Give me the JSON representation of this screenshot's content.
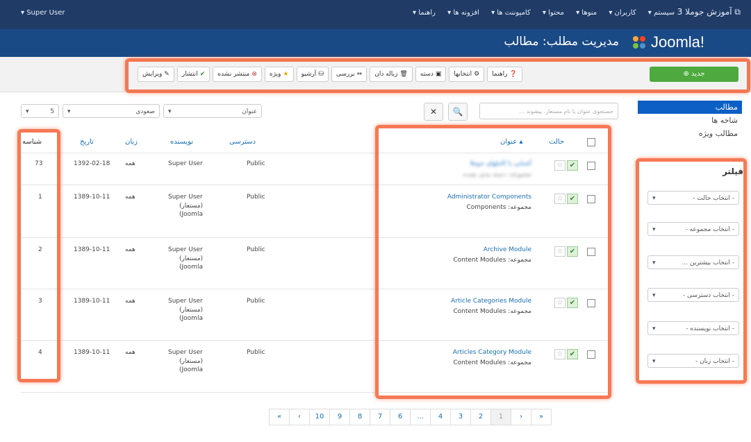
{
  "topbar": {
    "user_menu": "▾ Super User",
    "site_name": "آموزش جوملا 3 ⧉",
    "menu": [
      "سیستم ▾",
      "کاربران ▾",
      "منوها ▾",
      "محتوا ▾",
      "کامپوننت ها ▾",
      "افزونه ها ▾",
      "راهنما ▾"
    ]
  },
  "header": {
    "title": "مدیریت مطلب: مطالب",
    "logo_text": "Joomla!"
  },
  "toolbar": {
    "new_label": "⊕ جدید",
    "buttons": [
      {
        "icon": "✎",
        "label": "ویرایش"
      },
      {
        "icon": "✔",
        "label": "انتشار"
      },
      {
        "icon": "⊗",
        "label": "منتشر نشده"
      },
      {
        "icon": "★",
        "label": "ویژه"
      },
      {
        "icon": "⛁",
        "label": "آرشیو"
      },
      {
        "icon": "⇔",
        "label": "بررسی"
      },
      {
        "icon": "🗑",
        "label": "زباله دان"
      },
      {
        "icon": "▣",
        "label": "دسته"
      },
      {
        "icon": "⚙",
        "label": "انتخابها"
      },
      {
        "icon": "❓",
        "label": "راهنما"
      }
    ]
  },
  "sidebar": {
    "items": [
      "مطالب",
      "شاخه ها",
      "مطالب ویژه"
    ]
  },
  "filters": {
    "title": "فیلتر",
    "selects": [
      "- انتخاب حالت -",
      "- انتخاب مجموعه -",
      "- انتخاب بیشترین ...",
      "- انتخاب دسترسی -",
      "- انتخاب نویسنده -",
      "- انتخاب زبان -"
    ]
  },
  "search": {
    "placeholder": "جستجوی عنوان یا نام مستعار. پیشوند ..."
  },
  "sort": {
    "by": "عنوان",
    "dir": "صعودی",
    "limit": "5"
  },
  "table": {
    "headers": {
      "status": "حالت",
      "title": "عنوان ▴",
      "access": "دسترسی",
      "author": "نویسنده",
      "language": "زبان",
      "date": "تاریخ",
      "id": "شناسه"
    },
    "rows": [
      {
        "title": "آشنایی با کاملهای جوملا",
        "category": "مجموعه: دسته بندی نشده",
        "access": "Public",
        "author": "Super User",
        "author_alias": "",
        "language": "همه",
        "date": "1392-02-18",
        "id": "73",
        "blurred": true
      },
      {
        "title": "Administrator Components",
        "category": "مجموعه: Components",
        "access": "Public",
        "author": "Super User",
        "author_alias": "(مستعار)\n(Joomla",
        "language": "همه",
        "date": "1389-10-11",
        "id": "1",
        "blurred": false
      },
      {
        "title": "Archive Module",
        "category": "مجموعه: Content Modules",
        "access": "Public",
        "author": "Super User",
        "author_alias": "(مستعار)\n(Joomla",
        "language": "همه",
        "date": "1389-10-11",
        "id": "2",
        "blurred": false
      },
      {
        "title": "Article Categories Module",
        "category": "مجموعه: Content Modules",
        "access": "Public",
        "author": "Super User",
        "author_alias": "(مستعار)\n(Joomla",
        "language": "همه",
        "date": "1389-10-11",
        "id": "3",
        "blurred": false
      },
      {
        "title": "Articles Category Module",
        "category": "مجموعه: Content Modules",
        "access": "Public",
        "author": "Super User",
        "author_alias": "(مستعار)\n(Joomla",
        "language": "همه",
        "date": "1389-10-11",
        "id": "4",
        "blurred": false
      }
    ]
  },
  "pagination": [
    "«",
    "‹",
    "1",
    "2",
    "3",
    "4",
    "...",
    "6",
    "7",
    "8",
    "9",
    "10",
    "›",
    "»"
  ],
  "colors": {
    "topbar": "#1f3b66",
    "header": "#1a4a86",
    "new_button": "#4eaa3f",
    "highlight": "#f46237",
    "link": "#1a6fb0"
  }
}
